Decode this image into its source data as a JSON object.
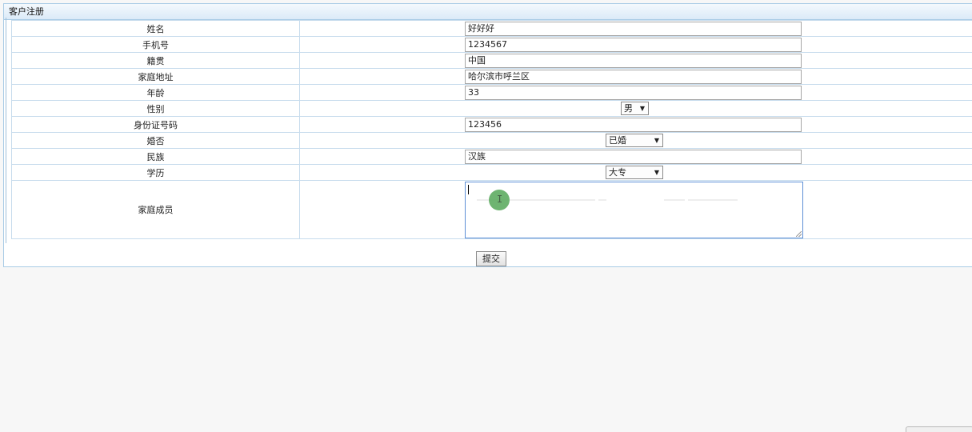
{
  "panel": {
    "title": "客户注册"
  },
  "form": {
    "name_label": "姓名",
    "name_value": "好好好",
    "phone_label": "手机号",
    "phone_value": "1234567",
    "origin_label": "籍贯",
    "origin_value": "中国",
    "address_label": "家庭地址",
    "address_value": "哈尔滨市呼兰区",
    "age_label": "年龄",
    "age_value": "33",
    "gender_label": "性别",
    "gender_value": "男",
    "id_label": "身份证号码",
    "id_value": "123456",
    "marital_label": "婚否",
    "marital_value": "已婚",
    "ethnic_label": "民族",
    "ethnic_value": "汉族",
    "education_label": "学历",
    "education_value": "大专",
    "family_label": "家庭成员",
    "family_value": "",
    "submit_label": "提交"
  },
  "icons": {
    "dropdown": "chevron-down-icon",
    "cursor": "text-cursor-icon"
  },
  "colors": {
    "header_bg": "#dbeaf8",
    "border": "#c7dced",
    "focus_border": "#5d8fd6",
    "cursor_highlight": "#67b06a"
  }
}
